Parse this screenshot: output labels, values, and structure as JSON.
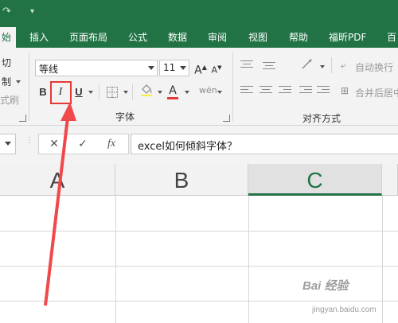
{
  "ribbon_tabs": [
    "始",
    "插入",
    "页面布局",
    "公式",
    "数据",
    "审阅",
    "视图",
    "帮助",
    "福昕PDF",
    "百"
  ],
  "clipboard": {
    "cut": "切",
    "copy": "制",
    "format_painter": "式刷"
  },
  "font": {
    "name": "等线",
    "size": "11",
    "grow_label": "A",
    "shrink_label": "A",
    "bold_label": "B",
    "italic_label": "I",
    "underline_label": "U",
    "font_color_label": "A",
    "group_label": "字体"
  },
  "alignment": {
    "wrap_text": "自动换行",
    "merge_center": "合并后居中",
    "group_label": "对齐方式"
  },
  "formula_bar": {
    "cancel_label": "✕",
    "enter_label": "✓",
    "fx_label": "fx",
    "content": "excel如何倾斜字体？"
  },
  "columns": [
    "A",
    "B",
    "C"
  ],
  "selected_column": "C",
  "watermark": {
    "text": "Bai 经验",
    "sub": "jingyan.baidu.com"
  },
  "colors": {
    "accent": "#217346",
    "annotation": "#e53935"
  }
}
